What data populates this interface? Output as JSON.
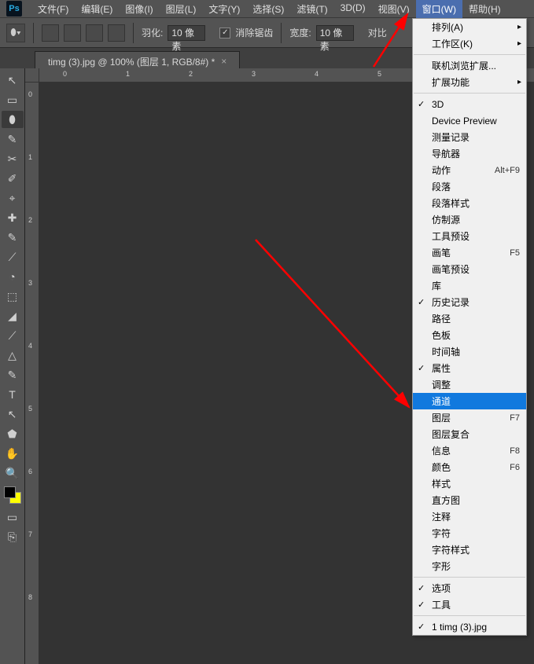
{
  "menubar": {
    "items": [
      "文件(F)",
      "编辑(E)",
      "图像(I)",
      "图层(L)",
      "文字(Y)",
      "选择(S)",
      "滤镜(T)",
      "3D(D)",
      "视图(V)",
      "窗口(W)",
      "帮助(H)"
    ],
    "active_index": 9
  },
  "logo": "Ps",
  "options": {
    "feather_label": "羽化:",
    "feather_value": "10 像素",
    "antialias_label": "消除锯齿",
    "width_label": "宽度:",
    "width_value": "10 像素",
    "contrast_label": "对比"
  },
  "tab": {
    "title": "timg (3).jpg @ 100% (图层 1, RGB/8#) *",
    "close": "×"
  },
  "ruler_h": [
    "0",
    "1",
    "2",
    "3",
    "4",
    "5"
  ],
  "ruler_v": [
    "0",
    "1",
    "2",
    "3",
    "4",
    "5",
    "6",
    "7",
    "8"
  ],
  "tools": [
    "↖",
    "▭",
    "⬮",
    "✎",
    "✂",
    "✐",
    "⌖",
    "✚",
    "✎",
    "⟋",
    "◔",
    "⬚",
    "◢",
    "⟋",
    "△",
    "✎",
    "T",
    "↖",
    "⬟",
    "✋",
    "🔍"
  ],
  "dropdown": {
    "groups": [
      [
        {
          "label": "排列(A)",
          "sub": true
        },
        {
          "label": "工作区(K)",
          "sub": true
        }
      ],
      [
        {
          "label": "联机浏览扩展..."
        },
        {
          "label": "扩展功能",
          "sub": true
        }
      ],
      [
        {
          "label": "3D",
          "checked": true
        },
        {
          "label": "Device Preview"
        },
        {
          "label": "测量记录"
        },
        {
          "label": "导航器"
        },
        {
          "label": "动作",
          "shortcut": "Alt+F9"
        },
        {
          "label": "段落"
        },
        {
          "label": "段落样式"
        },
        {
          "label": "仿制源"
        },
        {
          "label": "工具预设"
        },
        {
          "label": "画笔",
          "shortcut": "F5"
        },
        {
          "label": "画笔预设"
        },
        {
          "label": "库"
        },
        {
          "label": "历史记录",
          "checked": true
        },
        {
          "label": "路径"
        },
        {
          "label": "色板"
        },
        {
          "label": "时间轴"
        },
        {
          "label": "属性",
          "checked": true
        },
        {
          "label": "调整"
        },
        {
          "label": "通道",
          "highlight": true
        },
        {
          "label": "图层",
          "shortcut": "F7"
        },
        {
          "label": "图层复合"
        },
        {
          "label": "信息",
          "shortcut": "F8"
        },
        {
          "label": "颜色",
          "shortcut": "F6"
        },
        {
          "label": "样式"
        },
        {
          "label": "直方图"
        },
        {
          "label": "注释"
        },
        {
          "label": "字符"
        },
        {
          "label": "字符样式"
        },
        {
          "label": "字形"
        }
      ],
      [
        {
          "label": "选项",
          "checked": true
        },
        {
          "label": "工具",
          "checked": true
        }
      ],
      [
        {
          "label": "1 timg (3).jpg",
          "checked": true
        }
      ]
    ]
  }
}
